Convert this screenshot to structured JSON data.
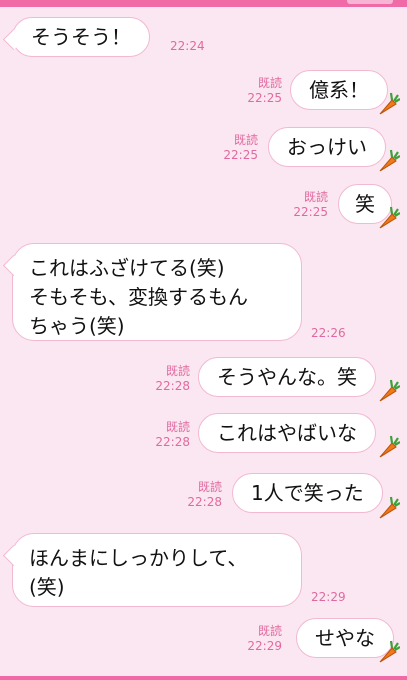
{
  "colors": {
    "background": "#fbe7f1",
    "bubble": "#ffffff",
    "bubble_border": "#f2b9d2",
    "meta_text": "#e06aa0",
    "accent_bar": "#f06aa8"
  },
  "read_label": "既読",
  "messages": [
    {
      "side": "received",
      "text": "そうそう！",
      "time": "22:24"
    },
    {
      "side": "sent",
      "text": "億系！",
      "time": "22:25",
      "read": "既読",
      "sticker": "carrot-icon"
    },
    {
      "side": "sent",
      "text": "おっけい",
      "time": "22:25",
      "read": "既読",
      "sticker": "carrot-icon"
    },
    {
      "side": "sent",
      "text": "笑",
      "time": "22:25",
      "read": "既読",
      "sticker": "carrot-icon"
    },
    {
      "side": "received",
      "text": "これはふざけてる(笑)\nそもそも、変換するもん\nちゃう(笑)",
      "time": "22:26"
    },
    {
      "side": "sent",
      "text": "そうやんな。笑",
      "time": "22:28",
      "read": "既読",
      "sticker": "carrot-icon"
    },
    {
      "side": "sent",
      "text": "これはやばいな",
      "time": "22:28",
      "read": "既読",
      "sticker": "carrot-icon"
    },
    {
      "side": "sent",
      "text": "1人で笑った",
      "time": "22:28",
      "read": "既読",
      "sticker": "carrot-icon"
    },
    {
      "side": "received",
      "text": "ほんまにしっかりして、\n(笑)",
      "time": "22:29"
    },
    {
      "side": "sent",
      "text": "せやな",
      "time": "22:29",
      "read": "既読",
      "sticker": "carrot-icon"
    }
  ]
}
